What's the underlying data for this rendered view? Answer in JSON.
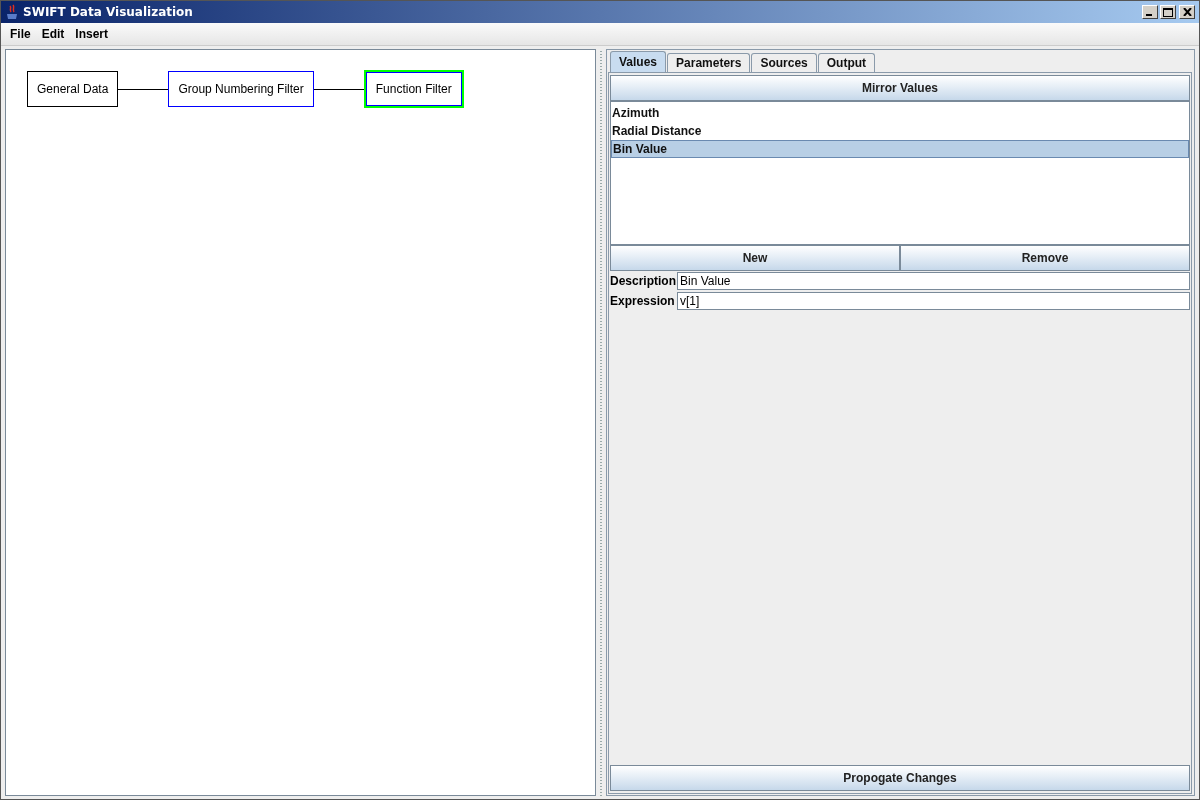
{
  "window": {
    "title": "SWIFT Data Visualization"
  },
  "menu": [
    {
      "label": "File"
    },
    {
      "label": "Edit"
    },
    {
      "label": "Insert"
    }
  ],
  "diagram": {
    "nodes": [
      {
        "label": "General Data",
        "color": "#000000",
        "selected": false
      },
      {
        "label": "Group Numbering Filter",
        "color": "#0000ff",
        "selected": false
      },
      {
        "label": "Function Filter",
        "color": "#0000ff",
        "selected": true
      }
    ]
  },
  "tabs": [
    {
      "label": "Values",
      "selected": true
    },
    {
      "label": "Parameters",
      "selected": false
    },
    {
      "label": "Sources",
      "selected": false
    },
    {
      "label": "Output",
      "selected": false
    }
  ],
  "mirror_button": "Mirror Values",
  "values_list": [
    {
      "label": "Azimuth",
      "selected": false
    },
    {
      "label": "Radial Distance",
      "selected": false
    },
    {
      "label": "Bin Value",
      "selected": true
    }
  ],
  "list_buttons": [
    "New",
    "Remove"
  ],
  "fields": [
    {
      "label": "Description",
      "value": "Bin Value"
    },
    {
      "label": "Expression",
      "value": "v[1]"
    }
  ],
  "apply_button": "Propogate Changes"
}
